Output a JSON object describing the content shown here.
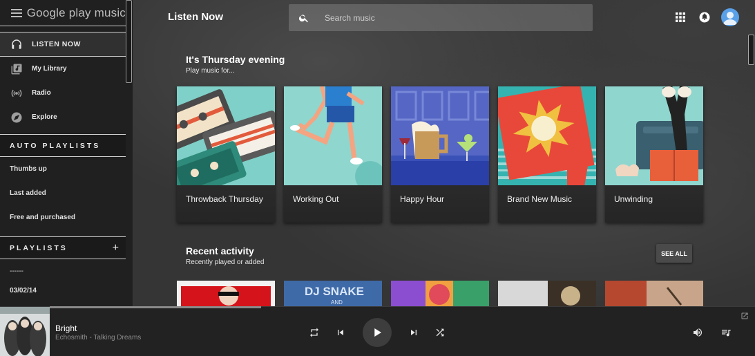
{
  "app": {
    "logo_text": "Google play music"
  },
  "sidebar": {
    "items": [
      {
        "label": "LISTEN NOW",
        "icon": "headphones-icon",
        "active": true
      },
      {
        "label": "My Library",
        "icon": "library-icon"
      },
      {
        "label": "Radio",
        "icon": "radio-icon"
      },
      {
        "label": "Explore",
        "icon": "compass-icon"
      }
    ],
    "auto_playlists": {
      "title": "AUTO PLAYLISTS",
      "items": [
        "Thumbs up",
        "Last added",
        "Free and purchased"
      ]
    },
    "playlists": {
      "title": "PLAYLISTS",
      "add_label": "+",
      "items": [
        "------",
        "03/02/14"
      ]
    }
  },
  "header": {
    "title": "Listen Now",
    "search_placeholder": "Search music"
  },
  "listen_now": {
    "title": "It's Thursday evening",
    "subtitle": "Play music for...",
    "cards": [
      {
        "label": "Throwback Thursday"
      },
      {
        "label": "Working Out"
      },
      {
        "label": "Happy Hour"
      },
      {
        "label": "Brand New Music"
      },
      {
        "label": "Unwinding"
      }
    ]
  },
  "recent": {
    "title": "Recent activity",
    "subtitle": "Recently played or added",
    "see_all_label": "SEE ALL",
    "dj_text_1": "DJ SNAKE",
    "dj_text_2": "AND"
  },
  "player": {
    "track_title": "Bright",
    "track_artist": "Echosmith - Talking Dreams",
    "progress": 0.28
  },
  "colors": {
    "sidebar_bg": "#202020",
    "main_bg": "#353535",
    "player_bg": "#222222",
    "accent_avatar": "#5aa0e8"
  }
}
